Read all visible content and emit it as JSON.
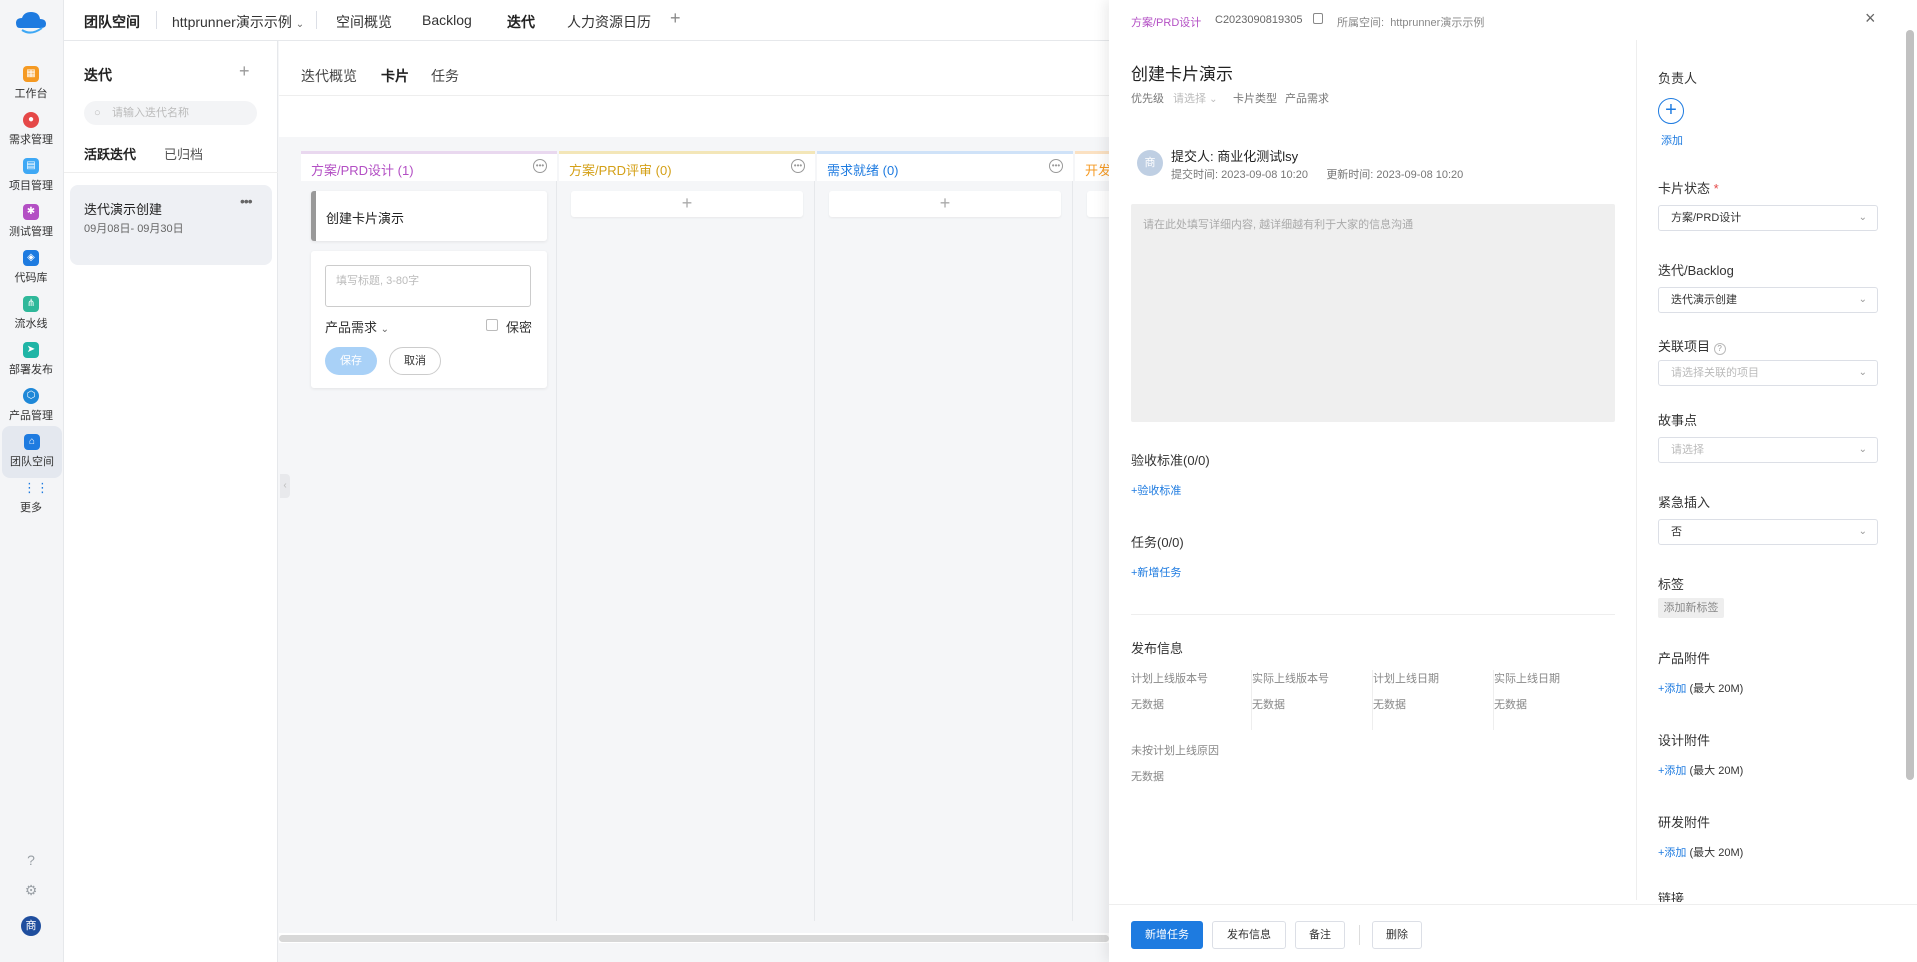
{
  "rail": {
    "items": [
      {
        "label": "工作台",
        "color": "#f59a23"
      },
      {
        "label": "需求管理",
        "color": "#e54848"
      },
      {
        "label": "项目管理",
        "color": "#3ea8f5"
      },
      {
        "label": "测试管理",
        "color": "#b34fc4"
      },
      {
        "label": "代码库",
        "color": "#1e7be0"
      },
      {
        "label": "流水线",
        "color": "#2fb89a"
      },
      {
        "label": "部署发布",
        "color": "#1fb5a6"
      },
      {
        "label": "产品管理",
        "color": "#1e88d8"
      },
      {
        "label": "团队空间",
        "color": "#1e7be0"
      },
      {
        "label": "更多",
        "color": "#1e7be0"
      }
    ],
    "avatar": "商"
  },
  "topbar": {
    "space_title": "团队空间",
    "project": "httprunner演示示例",
    "nav": [
      "空间概览",
      "Backlog",
      "迭代",
      "人力资源日历"
    ]
  },
  "iterations": {
    "title": "迭代",
    "search_placeholder": "请输入迭代名称",
    "tab_active": "活跃迭代",
    "tab_archived": "已归档",
    "item_name": "迭代演示创建",
    "item_dates": "09月08日- 09月30日"
  },
  "board": {
    "tabs": [
      "迭代概览",
      "卡片",
      "任务"
    ],
    "columns": [
      {
        "title": "方案/PRD设计 (1)",
        "color": "#b34fc4"
      },
      {
        "title": "方案/PRD评审 (0)",
        "color": "#d4a017"
      },
      {
        "title": "需求就绪 (0)",
        "color": "#1e7be0"
      },
      {
        "title": "开发",
        "color": "#f59a23"
      }
    ],
    "card_title": "创建卡片演示",
    "new_card": {
      "placeholder": "填写标题, 3-80字",
      "type": "产品需求",
      "secret": "保密",
      "save": "保存",
      "cancel": "取消"
    }
  },
  "drawer": {
    "status": "方案/PRD设计",
    "code": "C2023090819305",
    "space_label": "所属空间:",
    "space_value": "httprunner演示示例",
    "title": "创建卡片演示",
    "priority_label": "优先级",
    "priority_value": "请选择",
    "card_type_label": "卡片类型",
    "card_type_value": "产品需求",
    "submitter_avatar": "商",
    "submitter": "提交人: 商业化测试lsy",
    "submit_time": "提交时间:   2023-09-08 10:20",
    "update_time": "更新时间:   2023-09-08 10:20",
    "desc_placeholder": "请在此处填写详细内容, 越详细越有利于大家的信息沟通",
    "acceptance_title": "验收标准(0/0)",
    "acceptance_add": "+验收标准",
    "tasks_title": "任务(0/0)",
    "tasks_add": "+新增任务",
    "release_title": "发布信息",
    "release_cols": [
      {
        "label": "计划上线版本号",
        "value": "无数据"
      },
      {
        "label": "实际上线版本号",
        "value": "无数据"
      },
      {
        "label": "计划上线日期",
        "value": "无数据"
      },
      {
        "label": "实际上线日期",
        "value": "无数据"
      }
    ],
    "unplanned_label": "未按计划上线原因",
    "unplanned_value": "无数据",
    "side": {
      "owner_label": "负责人",
      "owner_add": "添加",
      "status_label": "卡片状态",
      "status_required": "*",
      "status_value": "方案/PRD设计",
      "iteration_label": "迭代/Backlog",
      "iteration_value": "迭代演示创建",
      "project_label": "关联项目",
      "project_placeholder": "请选择关联的项目",
      "story_label": "故事点",
      "story_placeholder": "请选择",
      "urgent_label": "紧急插入",
      "urgent_value": "否",
      "tags_label": "标签",
      "tags_add": "添加新标签",
      "prod_attach_label": "产品附件",
      "design_attach_label": "设计附件",
      "dev_attach_label": "研发附件",
      "attach_add": "+添加",
      "attach_limit": "(最大 20M)",
      "link_label": "链接"
    },
    "footer": {
      "new_task": "新增任务",
      "release": "发布信息",
      "remark": "备注",
      "delete": "删除"
    }
  }
}
